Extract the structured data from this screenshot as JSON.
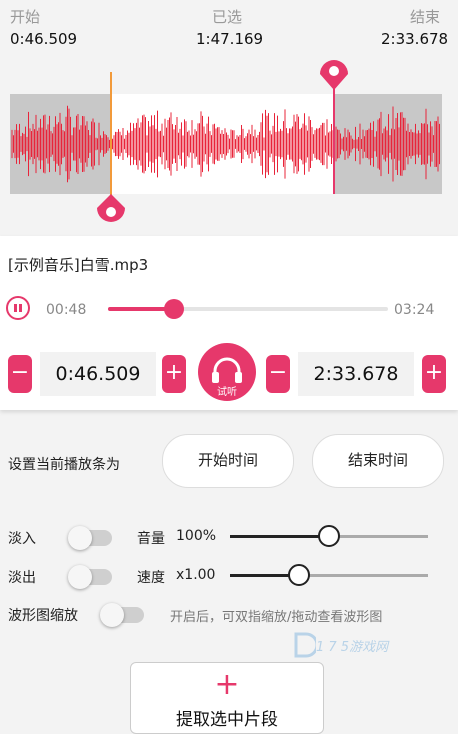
{
  "header": {
    "start_label": "开始",
    "selected_label": "已选",
    "end_label": "结束",
    "start_value": "0:46.509",
    "selected_value": "1:47.169",
    "end_value": "2:33.678"
  },
  "player": {
    "file_name": "[示例音乐]白雪.mp3",
    "current_time": "00:48",
    "total_time": "03:24",
    "progress_fraction": 0.235
  },
  "trim": {
    "start_value": "0:46.509",
    "end_value": "2:33.678",
    "minus_symbol": "−",
    "plus_symbol": "+",
    "preview_label": "试听"
  },
  "settings": {
    "set_current_label": "设置当前播放条为",
    "start_time_button": "开始时间",
    "end_time_button": "结束时间",
    "fade_in_label": "淡入",
    "fade_out_label": "淡出",
    "volume_label": "音量",
    "volume_value": "100%",
    "volume_fraction": 0.5,
    "speed_label": "速度",
    "speed_value": "x1.00",
    "speed_fraction": 0.35,
    "zoom_label": "波形图缩放",
    "zoom_hint": "开启后，可双指缩放/拖动查看波形图"
  },
  "actions": {
    "extract_plus": "+",
    "extract_label": "提取选中片段"
  },
  "watermark": {
    "text": "1 7 5游戏网"
  },
  "colors": {
    "accent": "#e6386b",
    "waveform": "#e8243a",
    "unselected_bg": "#c8c8c8",
    "start_marker": "#f29a3a"
  },
  "icons": {
    "pause": "pause-icon",
    "headphones": "headphones-icon",
    "marker": "location-pin-icon"
  }
}
